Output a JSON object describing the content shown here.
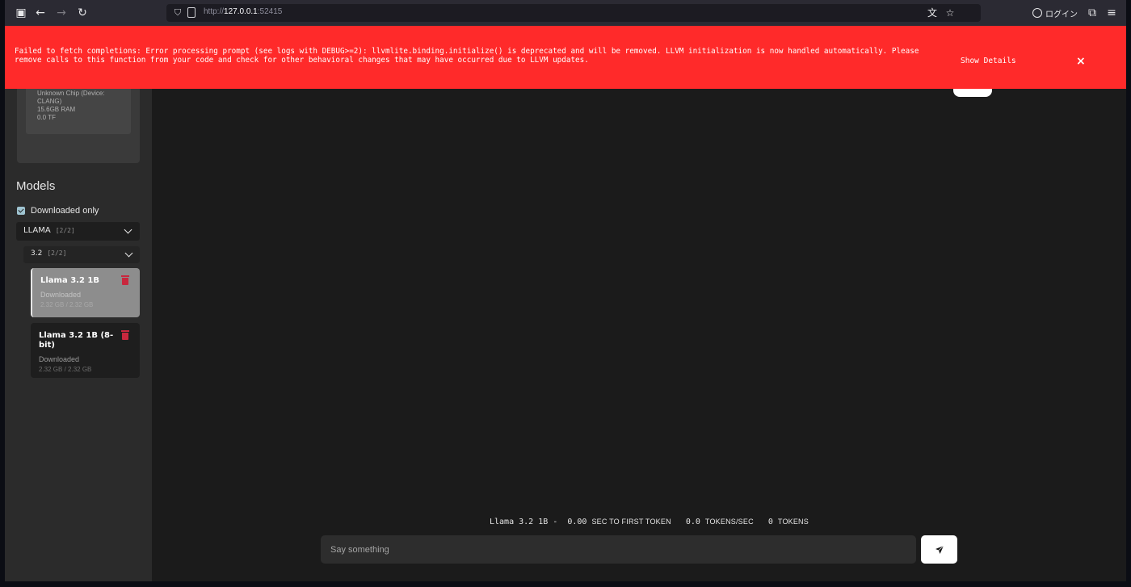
{
  "browser": {
    "url_scheme": "http://",
    "url_host": "127.0.0.1",
    "url_port": ":52415",
    "account_label": "ログイン"
  },
  "error": {
    "message": "Failed to fetch completions: Error processing prompt (see logs with DEBUG>=2): llvmlite.binding.initialize() is deprecated and will be removed. LLVM initialization is now handled automatically. Please remove calls to this function from your code and check for other behavioral changes that may have occurred due to LLVM updates.",
    "details_label": "Show Details",
    "close_label": "×"
  },
  "device": {
    "chip": "Unknown Chip (Device: CLANG)",
    "ram": "15.6GB RAM",
    "tflops": "0.0 TF"
  },
  "sidebar": {
    "models_title": "Models",
    "downloaded_only_label": "Downloaded only",
    "downloaded_only_checked": true,
    "family": {
      "name": "LLAMA",
      "count": "[2/2]"
    },
    "version": {
      "name": "3.2",
      "count": "[2/2]"
    },
    "models": [
      {
        "title": "Llama 3.2 1B",
        "status": "Downloaded",
        "size": "2.32 GB / 2.32 GB",
        "active": true
      },
      {
        "title": "Llama 3.2 1B (8-bit)",
        "status": "Downloaded",
        "size": "2.32 GB / 2.32 GB",
        "active": false
      }
    ]
  },
  "stats": {
    "model": "Llama 3.2 1B -",
    "ttft_value": "0.00",
    "ttft_label": "SEC TO FIRST TOKEN",
    "tps_value": "0.0",
    "tps_label": "TOKENS/SEC",
    "tokens_value": "0",
    "tokens_label": "TOKENS"
  },
  "chat": {
    "placeholder": "Say something",
    "value": ""
  },
  "colors": {
    "error_bg": "#ff2a2a",
    "sidebar_bg": "#2b2b2b",
    "main_bg": "#1b1b1b",
    "delete_icon": "#c8283e"
  }
}
